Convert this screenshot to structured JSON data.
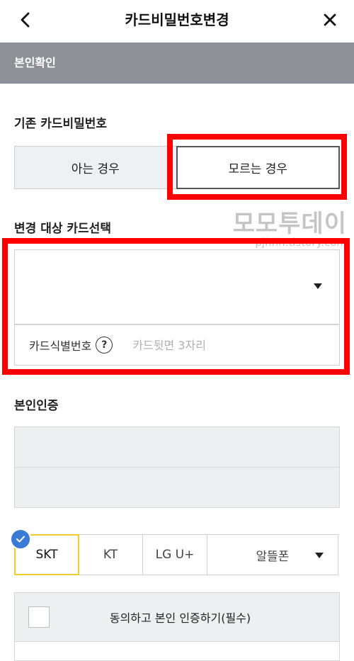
{
  "header": {
    "title": "카드비밀번호변경",
    "back_icon": "chevron-left-icon",
    "close_icon": "close-icon"
  },
  "section_bar": {
    "label": "본인확인"
  },
  "existing_pin": {
    "label": "기존 카드비밀번호",
    "options": [
      "아는 경우",
      "모르는 경우"
    ],
    "selected": "모르는 경우"
  },
  "card_select": {
    "label": "변경 대상 카드선택",
    "value": "",
    "id_label": "카드식별번호",
    "help_glyph": "?",
    "id_placeholder": "카드뒷면 3자리"
  },
  "verification": {
    "label": "본인인증",
    "carriers": [
      "SKT",
      "KT",
      "LG U+",
      "알뜰폰"
    ],
    "selected_carrier": "SKT",
    "consent_text": "동의하고 본인 인증하기(필수)"
  },
  "watermark": {
    "main": "모모투데이",
    "sub": "pjhhh.tistory.com"
  },
  "colors": {
    "section_bar": "#8e9097",
    "highlight_red": "#ff0000",
    "carrier_active_border": "#f3cb2a",
    "check_badge": "#3a7bd5"
  }
}
